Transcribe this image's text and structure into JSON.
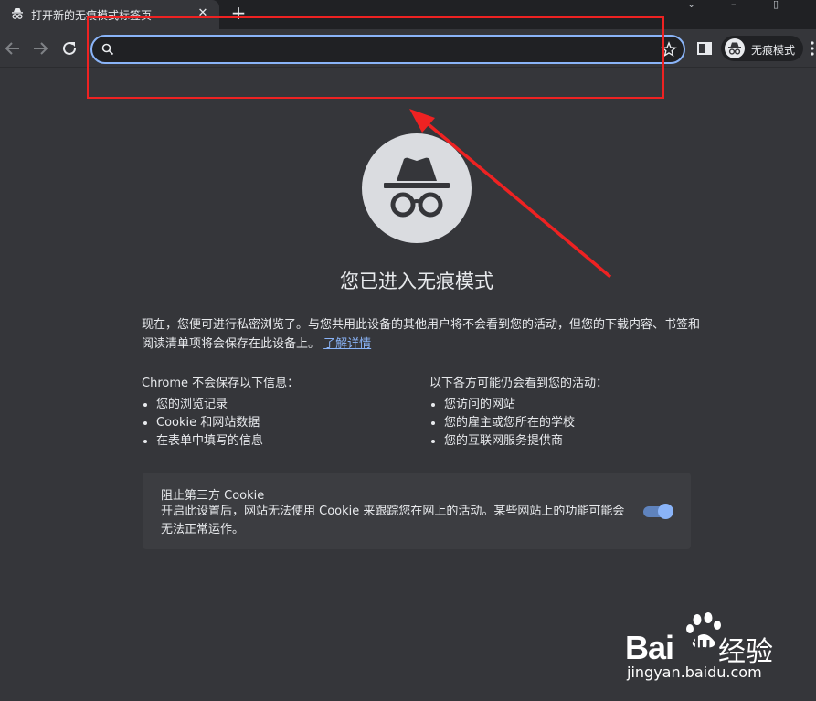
{
  "browser": {
    "tab": {
      "title": "打开新的无痕模式标签页",
      "close_icon": "close-icon",
      "favicon": "incognito-icon"
    },
    "new_tab_label": "+",
    "toolbar": {
      "back_icon": "arrow-back-icon",
      "forward_icon": "arrow-forward-icon",
      "reload_icon": "reload-icon",
      "omnibox": {
        "placeholder": "",
        "value": "",
        "search_icon": "search-icon",
        "bookmark_icon": "star-icon"
      },
      "side_panel_icon": "side-panel-icon",
      "profile_chip_label": "无痕模式"
    }
  },
  "page": {
    "title": "您已进入无痕模式",
    "intro_text": "现在，您便可进行私密浏览了。与您共用此设备的其他用户将不会看到您的活动，但您的下载内容、书签和阅读清单项将会保存在此设备上。",
    "learn_more_link": "了解详情",
    "not_saved": {
      "heading": "Chrome 不会保存以下信息：",
      "items": [
        "您的浏览记录",
        "Cookie 和网站数据",
        "在表单中填写的信息"
      ]
    },
    "may_see": {
      "heading": "以下各方可能仍会看到您的活动：",
      "items": [
        "您访问的网站",
        "您的雇主或您所在的学校",
        "您的互联网服务提供商"
      ]
    },
    "cookie_card": {
      "title": "阻止第三方 Cookie",
      "description": "开启此设置后，网站无法使用 Cookie 来跟踪您在网上的活动。某些网站上的功能可能会无法正常运作。",
      "toggle_on": true
    }
  },
  "watermark": {
    "brand_left": "Bai",
    "brand_right": "du",
    "product": "经验",
    "url": "jingyan.baidu.com"
  },
  "colors": {
    "background": "#35363a",
    "omnibox_focus": "#8ab4f8",
    "annotation": "#ee2222"
  }
}
